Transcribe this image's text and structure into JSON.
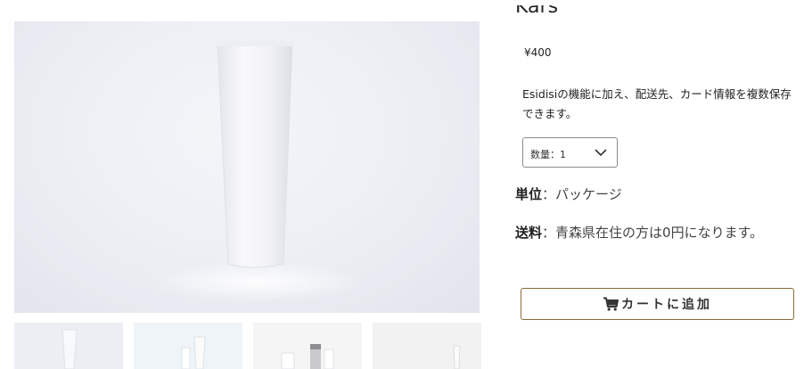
{
  "product": {
    "name": "Kars",
    "price": "¥400",
    "description": "Esidisiの機能に加え、配送先、カード情報を複数保存できます。",
    "quantity_select": {
      "selected": "数量：1"
    },
    "unit": {
      "label": "単位",
      "separator": "：",
      "value": "パッケージ"
    },
    "shipping": {
      "label": "送料",
      "separator": "：",
      "value": "青森県在住の方は0円になります。"
    }
  },
  "gallery": {
    "main_image": "white-cosmetic-tube",
    "thumbnails": [
      "white-tube",
      "cosmetic-bottles-blue",
      "cosmetic-set",
      "white-tube-grey"
    ]
  },
  "cart": {
    "button_label": "カートに追加",
    "icon": "cart-icon"
  },
  "colors": {
    "accent_border": "#8a6a36",
    "text": "#222222"
  }
}
